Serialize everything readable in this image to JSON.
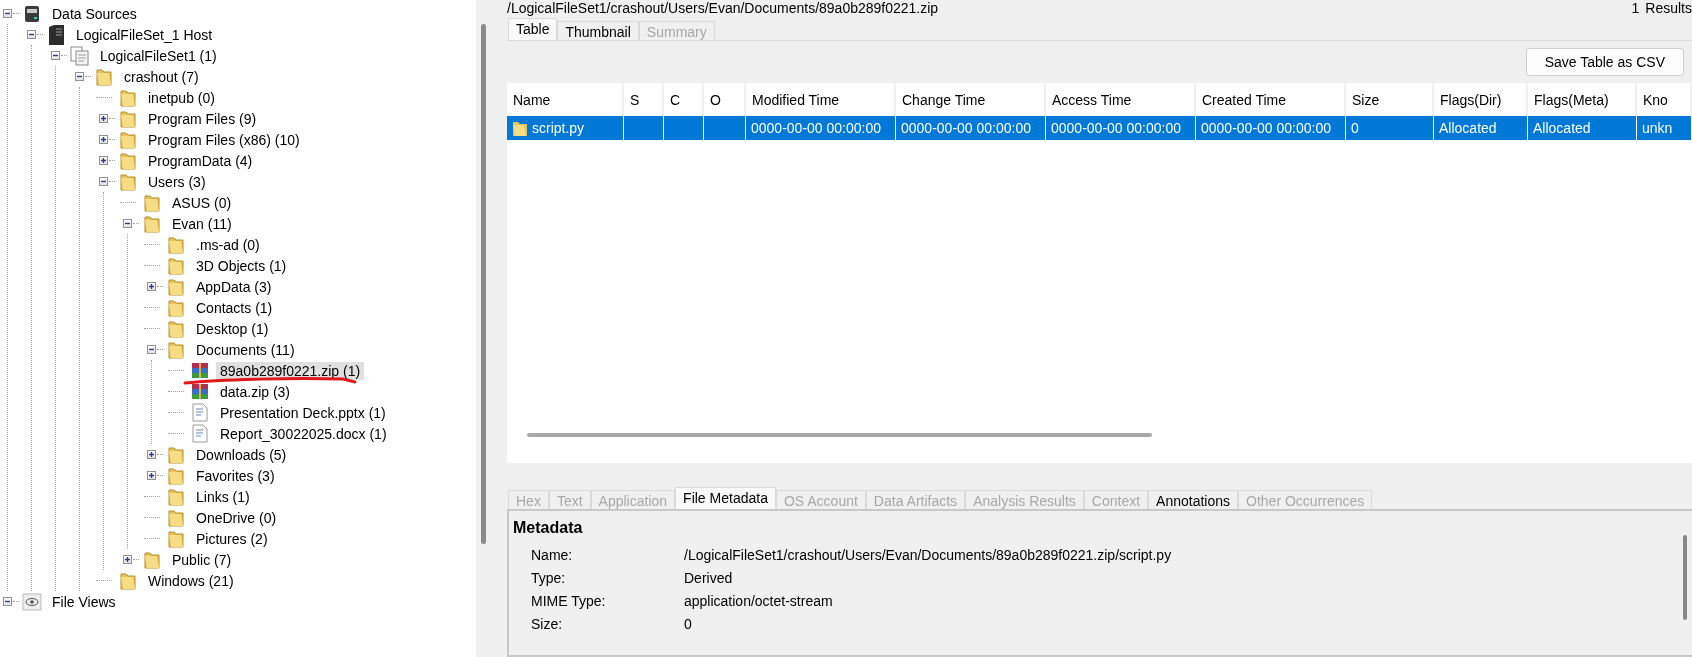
{
  "tree": [
    {
      "label": "Data Sources",
      "kind": "datasource",
      "expanded": true,
      "selected": false,
      "children": [
        {
          "label": "LogicalFileSet_1 Host",
          "kind": "host",
          "expanded": true,
          "selected": false,
          "children": [
            {
              "label": "LogicalFileSet1 (1)",
              "kind": "fileset",
              "expanded": true,
              "selected": false,
              "children": [
                {
                  "label": "crashout (7)",
                  "kind": "folder",
                  "expanded": true,
                  "selected": false,
                  "children": [
                    {
                      "label": "inetpub (0)",
                      "kind": "folder",
                      "selected": false
                    },
                    {
                      "label": "Program Files (9)",
                      "kind": "folder",
                      "expanded": false,
                      "selected": false
                    },
                    {
                      "label": "Program Files (x86) (10)",
                      "kind": "folder",
                      "expanded": false,
                      "selected": false
                    },
                    {
                      "label": "ProgramData (4)",
                      "kind": "folder",
                      "expanded": false,
                      "selected": false
                    },
                    {
                      "label": "Users (3)",
                      "kind": "folder",
                      "expanded": true,
                      "selected": false,
                      "children": [
                        {
                          "label": "ASUS (0)",
                          "kind": "folder",
                          "selected": false
                        },
                        {
                          "label": "Evan (11)",
                          "kind": "folder",
                          "expanded": true,
                          "selected": false,
                          "children": [
                            {
                              "label": ".ms-ad (0)",
                              "kind": "folder",
                              "selected": false
                            },
                            {
                              "label": "3D Objects (1)",
                              "kind": "folder",
                              "selected": false
                            },
                            {
                              "label": "AppData (3)",
                              "kind": "folder",
                              "expanded": false,
                              "selected": false
                            },
                            {
                              "label": "Contacts (1)",
                              "kind": "folder",
                              "selected": false
                            },
                            {
                              "label": "Desktop (1)",
                              "kind": "folder",
                              "selected": false
                            },
                            {
                              "label": "Documents (11)",
                              "kind": "folder",
                              "expanded": true,
                              "selected": false,
                              "children": [
                                {
                                  "label": "89a0b289f0221.zip (1)",
                                  "kind": "archive",
                                  "selected": true
                                },
                                {
                                  "label": "data.zip (3)",
                                  "kind": "archive",
                                  "selected": false
                                },
                                {
                                  "label": "Presentation Deck.pptx (1)",
                                  "kind": "document",
                                  "selected": false
                                },
                                {
                                  "label": "Report_30022025.docx (1)",
                                  "kind": "document",
                                  "selected": false
                                }
                              ]
                            },
                            {
                              "label": "Downloads (5)",
                              "kind": "folder",
                              "expanded": false,
                              "selected": false
                            },
                            {
                              "label": "Favorites (3)",
                              "kind": "folder",
                              "expanded": false,
                              "selected": false
                            },
                            {
                              "label": "Links (1)",
                              "kind": "folder",
                              "selected": false
                            },
                            {
                              "label": "OneDrive (0)",
                              "kind": "folder",
                              "selected": false
                            },
                            {
                              "label": "Pictures (2)",
                              "kind": "folder",
                              "selected": false
                            }
                          ]
                        },
                        {
                          "label": "Public (7)",
                          "kind": "folder",
                          "expanded": false,
                          "selected": false
                        }
                      ]
                    },
                    {
                      "label": "Windows (21)",
                      "kind": "folder",
                      "selected": false
                    }
                  ]
                }
              ]
            }
          ]
        }
      ]
    },
    {
      "label": "File Views",
      "kind": "views",
      "expanded": true,
      "selected": false
    }
  ],
  "path": "/LogicalFileSet1/crashout/Users/Evan/Documents/89a0b289f0221.zip",
  "result_count": "1",
  "result_label": "Results",
  "view_tabs": [
    {
      "label": "Table",
      "selected": true,
      "disabled": false
    },
    {
      "label": "Thumbnail",
      "selected": false,
      "disabled": false
    },
    {
      "label": "Summary",
      "selected": false,
      "disabled": true
    }
  ],
  "save_button": "Save Table as CSV",
  "table": {
    "columns": [
      "Name",
      "S",
      "C",
      "O",
      "Modified Time",
      "Change Time",
      "Access Time",
      "Created Time",
      "Size",
      "Flags(Dir)",
      "Flags(Meta)",
      "Kno"
    ],
    "rows": [
      {
        "selected": true,
        "cells": [
          "script.py",
          "",
          "",
          "",
          "0000-00-00 00:00:00",
          "0000-00-00 00:00:00",
          "0000-00-00 00:00:00",
          "0000-00-00 00:00:00",
          "0",
          "Allocated",
          "Allocated",
          "unkn"
        ]
      }
    ]
  },
  "detail_tabs": [
    {
      "label": "Hex",
      "selected": false,
      "disabled": true
    },
    {
      "label": "Text",
      "selected": false,
      "disabled": true
    },
    {
      "label": "Application",
      "selected": false,
      "disabled": true
    },
    {
      "label": "File Metadata",
      "selected": true,
      "disabled": false
    },
    {
      "label": "OS Account",
      "selected": false,
      "disabled": true
    },
    {
      "label": "Data Artifacts",
      "selected": false,
      "disabled": true
    },
    {
      "label": "Analysis Results",
      "selected": false,
      "disabled": true
    },
    {
      "label": "Context",
      "selected": false,
      "disabled": true
    },
    {
      "label": "Annotations",
      "selected": false,
      "disabled": false
    },
    {
      "label": "Other Occurrences",
      "selected": false,
      "disabled": true
    }
  ],
  "metadata": {
    "title": "Metadata",
    "rows": [
      {
        "label": "Name:",
        "value": "/LogicalFileSet1/crashout/Users/Evan/Documents/89a0b289f0221.zip/script.py"
      },
      {
        "label": "Type:",
        "value": "Derived"
      },
      {
        "label": "MIME Type:",
        "value": "application/octet-stream"
      },
      {
        "label": "Size:",
        "value": "0"
      }
    ]
  }
}
